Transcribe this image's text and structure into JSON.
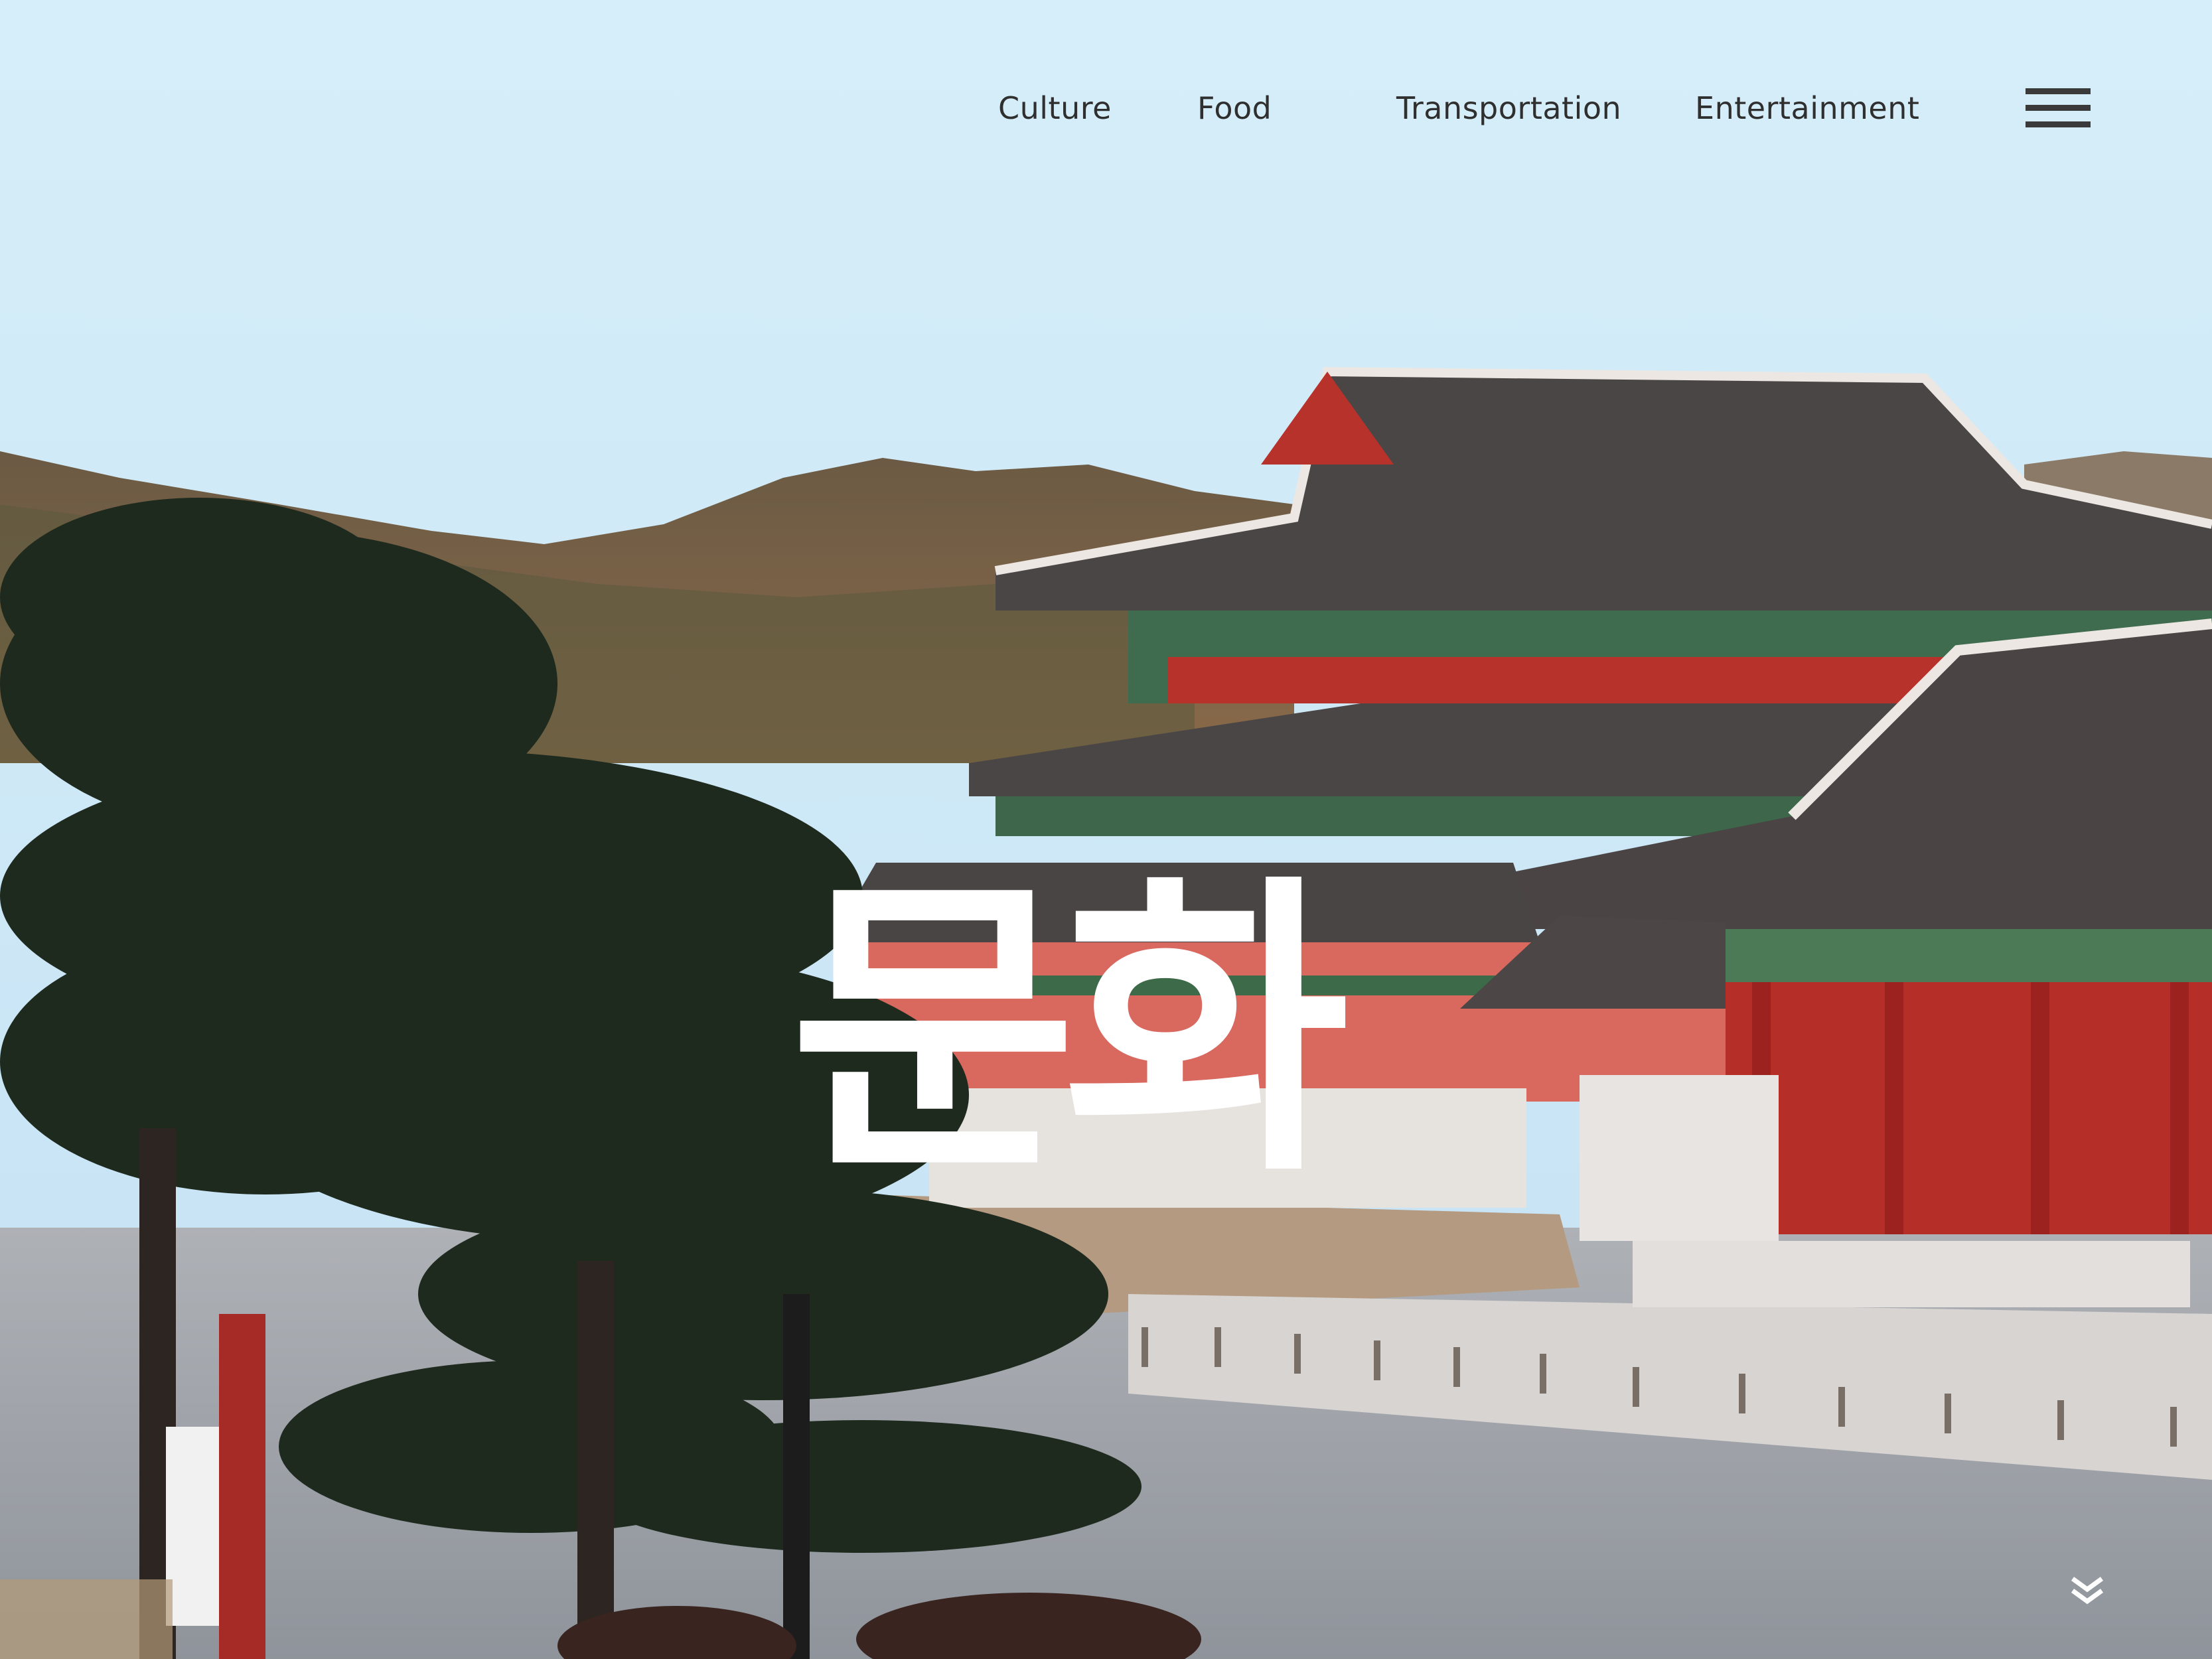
{
  "nav": {
    "items": [
      {
        "label": "Culture"
      },
      {
        "label": "Food"
      },
      {
        "label": "Transportation"
      },
      {
        "label": "Entertainment"
      }
    ],
    "menu_icon": "hamburger-menu-icon"
  },
  "hero": {
    "title": "문화",
    "background": "Gyeongbokgung palace hall with pine trees and mountains",
    "scroll_icon": "double-chevron-down-icon"
  },
  "colors": {
    "sky": "#d6ecf8",
    "nav_text": "#2f2f2f",
    "title": "#ffffff",
    "palace_red": "#b8322c",
    "roof": "#4a4444"
  }
}
